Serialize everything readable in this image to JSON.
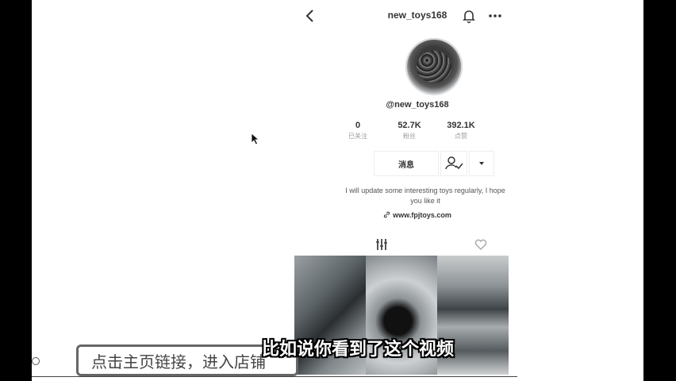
{
  "profile": {
    "nav_title": "new_toys168",
    "handle": "@new_toys168",
    "stats": [
      {
        "value": "0",
        "label": "已关注"
      },
      {
        "value": "52.7K",
        "label": "粉丝"
      },
      {
        "value": "392.1K",
        "label": "点赞"
      }
    ],
    "message_button": "消息",
    "bio": "I will update some interesting toys regularly, I hope you like it",
    "website": "www.fpjtoys.com"
  },
  "overlay": {
    "subtitle": "比如说你看到了这个视频",
    "caption_box": "点击主页链接，进入店铺"
  },
  "icons": [
    "back-arrow-icon",
    "bell-icon",
    "more-icon",
    "add-person-icon",
    "dropdown-icon",
    "link-icon",
    "videos-tab-icon",
    "liked-tab-icon",
    "mouse-cursor-icon"
  ]
}
